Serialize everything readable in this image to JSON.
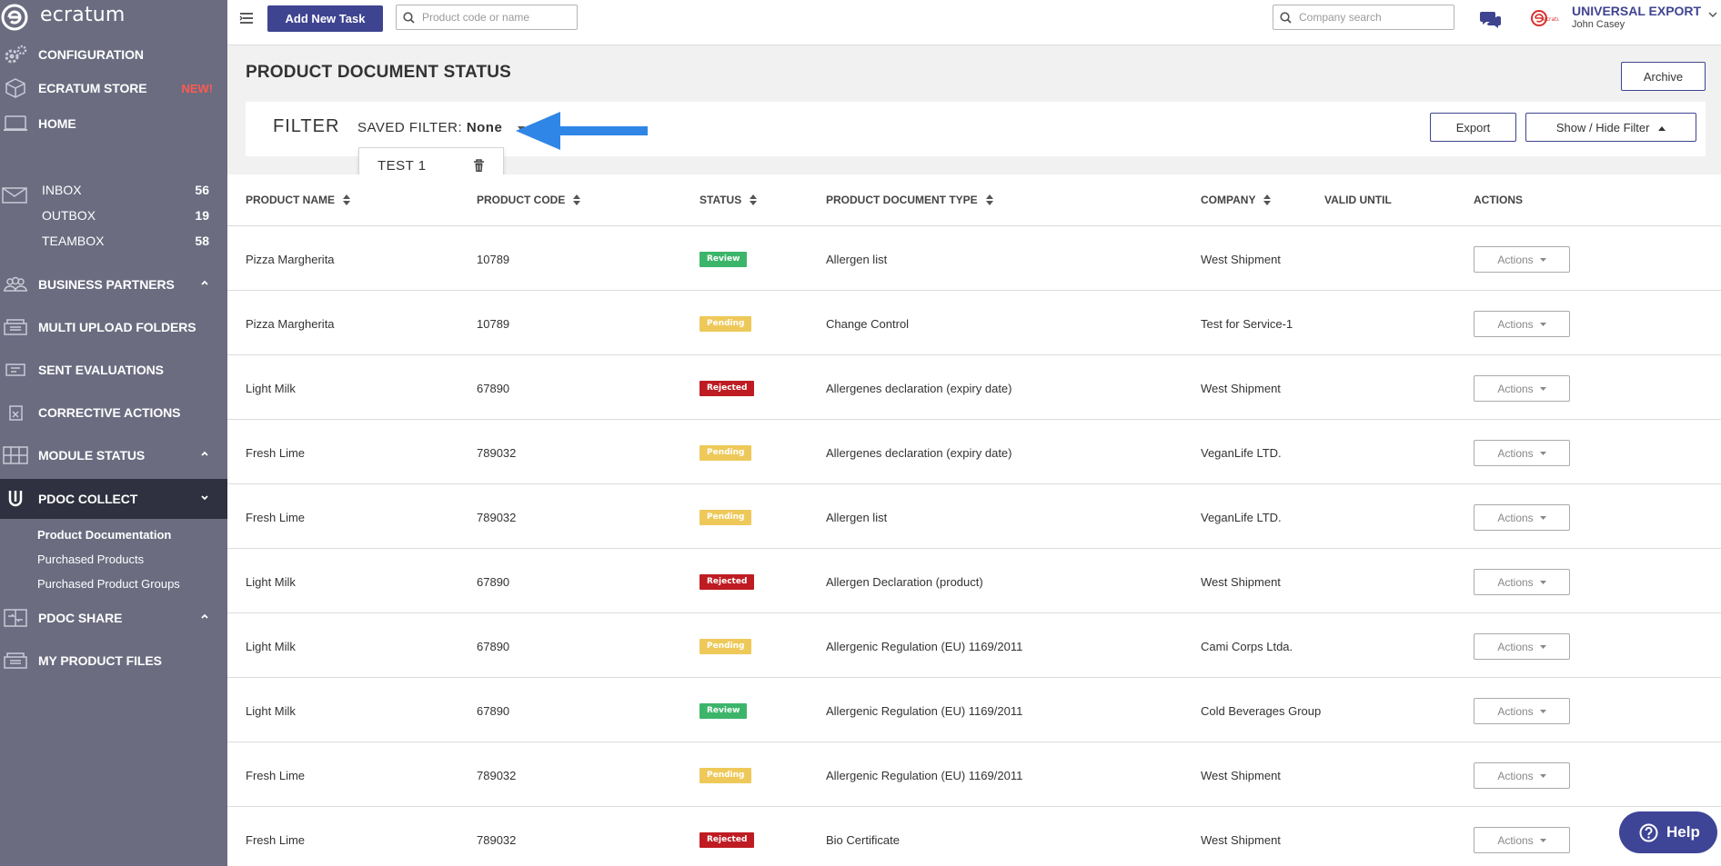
{
  "app": {
    "logo_text": "ecratum"
  },
  "sidebar": {
    "configuration": "CONFIGURATION",
    "store": "ECRATUM STORE",
    "store_badge": "NEW!",
    "home": "HOME",
    "inbox": {
      "label": "INBOX",
      "count": "56"
    },
    "outbox": {
      "label": "OUTBOX",
      "count": "19"
    },
    "teambox": {
      "label": "TEAMBOX",
      "count": "58"
    },
    "business_partners": "BUSINESS PARTNERS",
    "multi_upload": "MULTI UPLOAD FOLDERS",
    "sent_evaluations": "SENT EVALUATIONS",
    "corrective_actions": "CORRECTIVE ACTIONS",
    "module_status": "MODULE STATUS",
    "pdoc_collect": "PDOC COLLECT",
    "pdoc_collect_items": [
      "Product Documentation",
      "Purchased Products",
      "Purchased Product Groups"
    ],
    "pdoc_share": "PDOC SHARE",
    "my_product_files": "MY PRODUCT FILES"
  },
  "topbar": {
    "add_task": "Add New Task",
    "product_search_placeholder": "Product code or name",
    "company_search_placeholder": "Company search",
    "company_name": "UNIVERSAL EXPORT",
    "user_name": "John Casey",
    "brand_logo_text": "ecratum"
  },
  "page": {
    "title": "PRODUCT DOCUMENT STATUS",
    "archive": "Archive",
    "filter_title": "FILTER",
    "saved_filter_label": "SAVED FILTER:",
    "saved_filter_value": "None",
    "dropdown_option": "TEST 1",
    "export": "Export",
    "show_hide": "Show / Hide Filter"
  },
  "table": {
    "columns": {
      "product_name": "PRODUCT NAME",
      "product_code": "PRODUCT CODE",
      "status": "STATUS",
      "doc_type": "PRODUCT DOCUMENT TYPE",
      "company": "COMPANY",
      "valid_until": "VALID UNTIL",
      "actions": "ACTIONS"
    },
    "action_label": "Actions",
    "rows": [
      {
        "name": "Pizza Margherita",
        "code": "10789",
        "status": "Review",
        "status_class": "review",
        "type": "Allergen list",
        "company": "West Shipment",
        "valid": ""
      },
      {
        "name": "Pizza Margherita",
        "code": "10789",
        "status": "Pending",
        "status_class": "pending",
        "type": "Change Control",
        "company": "Test for Service-1",
        "valid": ""
      },
      {
        "name": "Light Milk",
        "code": "67890",
        "status": "Rejected",
        "status_class": "rejected",
        "type": "Allergenes declaration (expiry date)",
        "company": "West Shipment",
        "valid": ""
      },
      {
        "name": "Fresh Lime",
        "code": "789032",
        "status": "Pending",
        "status_class": "pending",
        "type": "Allergenes declaration (expiry date)",
        "company": "VeganLife LTD.",
        "valid": ""
      },
      {
        "name": "Fresh Lime",
        "code": "789032",
        "status": "Pending",
        "status_class": "pending",
        "type": "Allergen list",
        "company": "VeganLife LTD.",
        "valid": ""
      },
      {
        "name": "Light Milk",
        "code": "67890",
        "status": "Rejected",
        "status_class": "rejected",
        "type": "Allergen Declaration (product)",
        "company": "West Shipment",
        "valid": ""
      },
      {
        "name": "Light Milk",
        "code": "67890",
        "status": "Pending",
        "status_class": "pending",
        "type": "Allergenic Regulation (EU) 1169/2011",
        "company": "Cami Corps Ltda.",
        "valid": ""
      },
      {
        "name": "Light Milk",
        "code": "67890",
        "status": "Review",
        "status_class": "review",
        "type": "Allergenic Regulation (EU) 1169/2011",
        "company": "Cold Beverages Group",
        "valid": ""
      },
      {
        "name": "Fresh Lime",
        "code": "789032",
        "status": "Pending",
        "status_class": "pending",
        "type": "Allergenic Regulation (EU) 1169/2011",
        "company": "West Shipment",
        "valid": ""
      },
      {
        "name": "Fresh Lime",
        "code": "789032",
        "status": "Rejected",
        "status_class": "rejected",
        "type": "Bio Certificate",
        "company": "West Shipment",
        "valid": ""
      }
    ]
  },
  "help": {
    "label": "Help"
  },
  "colors": {
    "sidebar": "#6b6c80",
    "active_nav": "#2f3140",
    "primary": "#3f4490",
    "review": "#3cb56b",
    "pending": "#eec95a",
    "rejected": "#be1c22",
    "arrow": "#2f86e6"
  },
  "icons": [
    "menu-icon",
    "search-icon",
    "chat-icon",
    "gear-icon",
    "cube-icon",
    "home-icon",
    "mail-icon",
    "users-icon",
    "folder-icon",
    "evaluation-icon",
    "corrective-icon",
    "grid-icon",
    "collect-icon",
    "share-icon",
    "trash-icon",
    "sort-icon",
    "caret-down-icon",
    "caret-up-icon",
    "question-icon",
    "arrow-left-icon"
  ]
}
